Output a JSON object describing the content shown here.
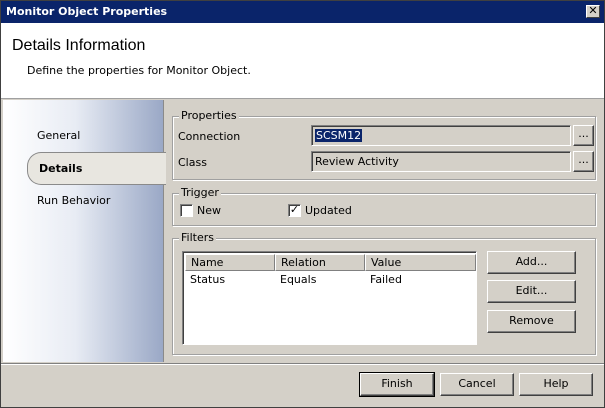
{
  "window": {
    "title": "Monitor Object Properties",
    "close_glyph": "✕"
  },
  "header": {
    "title": "Details Information",
    "subtitle": "Define the properties for Monitor Object."
  },
  "sidebar": {
    "items": [
      {
        "label": "General",
        "selected": false
      },
      {
        "label": "Details",
        "selected": true
      },
      {
        "label": "Run Behavior",
        "selected": false
      }
    ]
  },
  "properties": {
    "group_label": "Properties",
    "connection_label": "Connection",
    "connection_value": "SCSM12",
    "class_label": "Class",
    "class_value": "Review Activity",
    "browse_label": "..."
  },
  "trigger": {
    "group_label": "Trigger",
    "new_label": "New",
    "new_checked": false,
    "updated_label": "Updated",
    "updated_checked": true,
    "check_glyph": "✓"
  },
  "filters": {
    "group_label": "Filters",
    "columns": [
      "Name",
      "Relation",
      "Value"
    ],
    "rows": [
      {
        "name": "Status",
        "relation": "Equals",
        "value": "Failed"
      }
    ],
    "add_label": "Add...",
    "edit_label": "Edit...",
    "remove_label": "Remove"
  },
  "footer": {
    "finish_label": "Finish",
    "cancel_label": "Cancel",
    "help_label": "Help"
  }
}
